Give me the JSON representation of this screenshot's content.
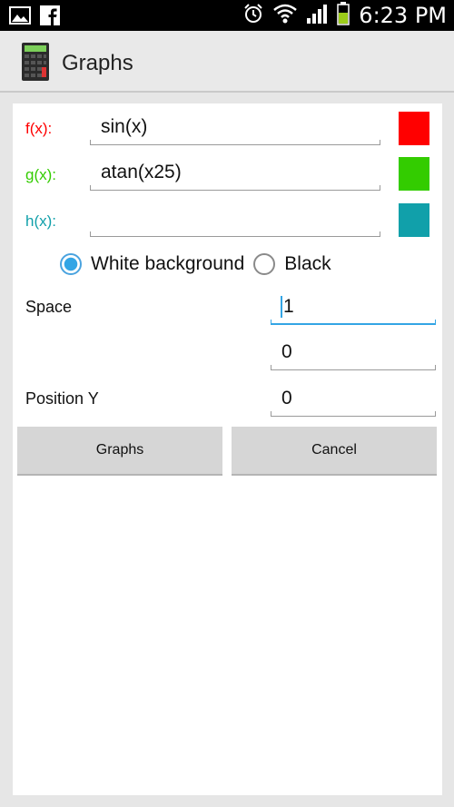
{
  "status_bar": {
    "time": "6:23 PM",
    "icons": [
      "gallery-icon",
      "facebook-icon",
      "alarm-icon",
      "wifi-icon",
      "signal-icon",
      "battery-icon"
    ]
  },
  "action_bar": {
    "title": "Graphs"
  },
  "functions": [
    {
      "label": "f(x):",
      "value": "sin(x)",
      "color": "#ff0000",
      "label_color": "#ff0000"
    },
    {
      "label": "g(x):",
      "value": "atan(x25)",
      "color": "#33cc00",
      "label_color": "#33cc00"
    },
    {
      "label": "h(x):",
      "value": "",
      "color": "#11a0aa",
      "label_color": "#11a0aa"
    }
  ],
  "background_options": [
    {
      "label": "White background",
      "selected": true
    },
    {
      "label": "Black",
      "selected": false
    }
  ],
  "fields": {
    "space_label": "Space",
    "space_value": "1",
    "second_value": "0",
    "position_y_label": "Position Y",
    "position_y_value": "0"
  },
  "buttons": {
    "graphs": "Graphs",
    "cancel": "Cancel"
  }
}
